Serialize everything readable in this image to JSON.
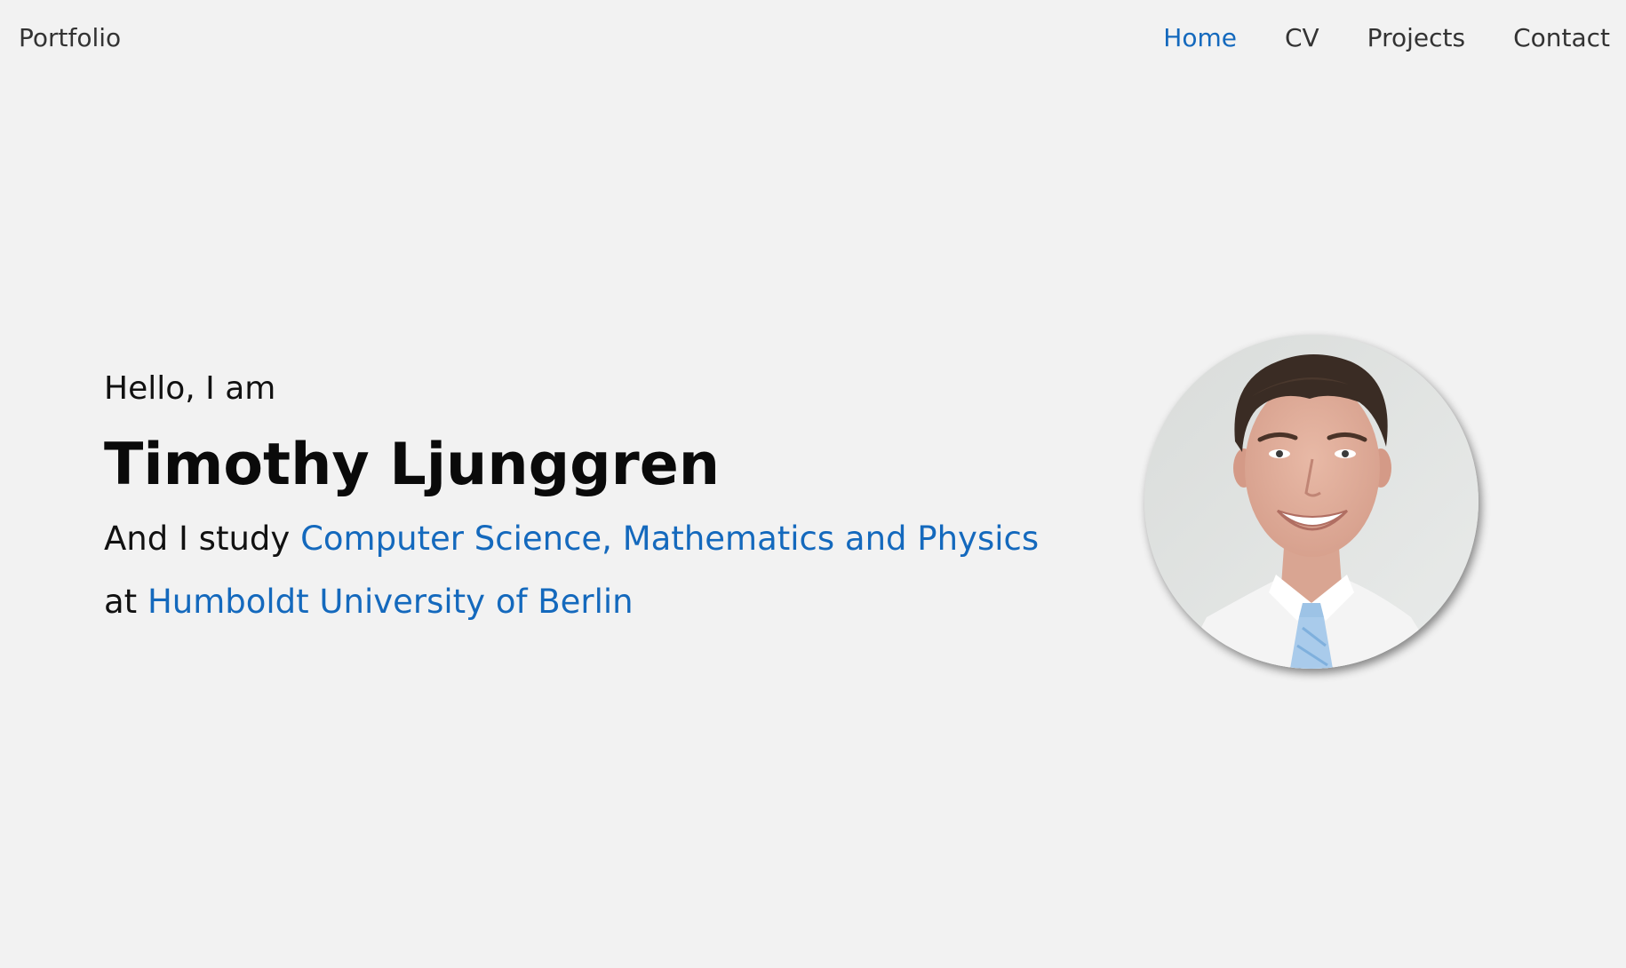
{
  "nav": {
    "brand": "Portfolio",
    "links": [
      {
        "label": "Home",
        "active": true
      },
      {
        "label": "CV",
        "active": false
      },
      {
        "label": "Projects",
        "active": false
      },
      {
        "label": "Contact",
        "active": false
      }
    ]
  },
  "hero": {
    "greeting": "Hello, I am",
    "name": "Timothy Ljunggren",
    "study_prefix": "And I study ",
    "study_subjects": "Computer Science, Mathematics and Physics",
    "institution_prefix": "at ",
    "institution": "Humboldt University of Berlin"
  },
  "colors": {
    "background": "#f2f2f2",
    "accent": "#1469bd",
    "text": "#111111"
  },
  "icons": {
    "profile_photo": "portrait-photo"
  }
}
